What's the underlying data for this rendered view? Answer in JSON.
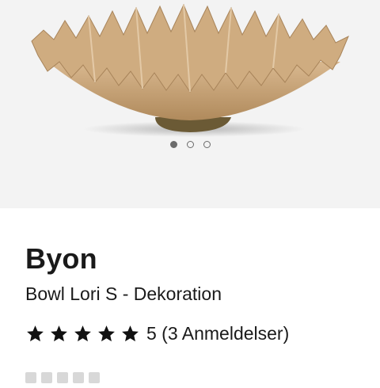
{
  "gallery": {
    "image_alt": "bowl-image",
    "dots": [
      true,
      false,
      false
    ]
  },
  "product": {
    "brand": "Byon",
    "name": "Bowl Lori S - Dekoration",
    "rating_stars": 5,
    "rating_text": "5 (3 Anmeldelser)"
  },
  "colors": {
    "bowl": "#c8a57c",
    "bowl_shadow": "#8a6a45",
    "base": "#6b5a35",
    "background": "#f3f3f3"
  }
}
